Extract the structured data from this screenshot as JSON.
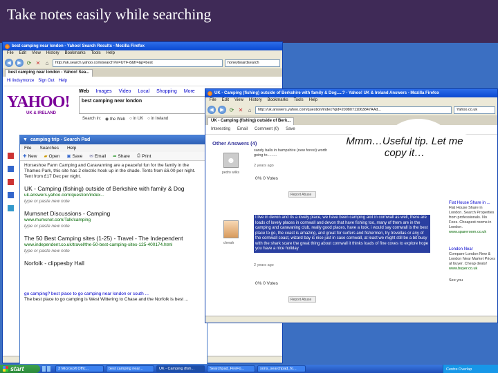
{
  "slide": {
    "title": "Take notes easily while searching"
  },
  "search_window": {
    "title": "best camping near london - Yahoo! Search Results - Mozilla Firefox",
    "menu": [
      "File",
      "Edit",
      "View",
      "History",
      "Bookmarks",
      "Tools",
      "Help"
    ],
    "url": "http://uk.search.yahoo.com/search?ei=UTF-8&fr=&p=best",
    "search_box": "honeyboardsearch",
    "tab_label": "best camping near london - Yahoo! Sea...",
    "header_links": [
      "Hi lindsymorze",
      "Sign Out",
      "Help"
    ],
    "logo": "YAHOO!",
    "logo_sub": "UK & IRELAND",
    "search_tabs": [
      "Web",
      "Images",
      "Video",
      "Local",
      "Shopping",
      "More"
    ],
    "query": "best camping near london",
    "search_in": {
      "label": "Search in:",
      "options": [
        "the Web",
        "in UK",
        "in Ireland"
      ]
    }
  },
  "search_pad": {
    "title": "camping trip - Search Pad",
    "menu": [
      "File",
      "Searches",
      "Help"
    ],
    "tools": [
      "New",
      "Open",
      "Save",
      "Email",
      "Share",
      "Print"
    ],
    "entries": [
      {
        "title": "Horseshoe Farm Camping and Caravanning are a peaceful fun for the family in the Thames Park, this site has 2 electric hook up in the shade. Tents from £6.00 per night. Tent from £17 Dec per night.",
        "url": "",
        "note": ""
      },
      {
        "title": "UK - Camping (fishing) outside of Berkshire with family & Dog",
        "url": "uk.answers.yahoo.com/question/index...",
        "note": "type or paste new note"
      },
      {
        "title": "Mumsnet Discussions - Camping",
        "url": "www.mumsnet.com/Talk/camping",
        "note": "type or paste new note"
      },
      {
        "title": "The 50 Best Camping sites (1-25) - Travel - The Independent",
        "url": "www.independent.co.uk/travel/the-50-best-camping-sites-125-400174.html",
        "note": "type or paste new note"
      },
      {
        "title": "Norfolk - clippesby Hall",
        "url": "",
        "note": ""
      }
    ],
    "bottom_note": "go camping? best place to go camping near london or south ...",
    "bottom_note2": "The best place to go camping is West Wittering to Chase and the Norfolk is best ..."
  },
  "answers_window": {
    "title": "UK - Camping (fishing) outside of Berkshire with family & Dog.....? - Yahoo! UK & Ireland Answers - Mozilla Firefox",
    "menu": [
      "File",
      "Edit",
      "View",
      "History",
      "Bookmarks",
      "Tools",
      "Help"
    ],
    "url": "http://uk.answers.yahoo.com/question/index?qid=20080711063847AAd...",
    "search_box": "Yahoo.co.uk",
    "tab_label": "UK - Camping (fishing) outside of Berk...",
    "toolbar": [
      "Interesting",
      "Email",
      "Comment (0)",
      "Save"
    ],
    "heading": "Other Answers (4)",
    "answer1": {
      "user": "pedro wilks",
      "text": "sandy balls in hampshire (new forest) worth going to.........",
      "ago": "2 years ago",
      "votes": "0% 0 Votes",
      "report": "Report Abuse"
    },
    "answer2": {
      "user": "cherah",
      "text": "I live in devon and its a lovely place, we have been camping alot in cornwall as well, there are loads of lovely places in cornwall and devon that have fishing too, many of them are in the camping and caravaning club, really good places, have a look, i would say cornwall is the best place to go, the coast is amazing, and great for surfers and fishermen, try trevellas or any of the cornwall coast, wizard bay is nice just in case cornwall, at least we might still be a bit busy with the shark scare the great thing about cornwall it thinks loads of fine coves to explore hope you have a nice holiday",
      "ago": "2 years ago",
      "votes": "0% 0 Votes",
      "report": "Report Abuse"
    },
    "ads": [
      {
        "head": "Flat House Share in ...",
        "body": "Flat House Share in London. Search Properties from professionals. No Fees. Cheapest rooms in London.",
        "url": "www.spareroom.co.uk"
      },
      {
        "head": "London Near",
        "body": "Compare London New & London Near Market Prices at buyer. Cheap deals!",
        "url": "www.buyer.co.uk"
      }
    ],
    "see_your": "See you"
  },
  "thought_bubble": {
    "text": "Mmm…Useful tip. Let me copy it…"
  },
  "taskbar": {
    "start": "start",
    "tasks": [
      "3 Microsoft Offic...",
      "best camping near...",
      "UK - Camping (fish...",
      "Searchpad_FireFo...",
      "sons_searchpad_fo..."
    ],
    "tray_text": "Centre Overlap"
  },
  "colors": {
    "slide_bg": "#3f2a57",
    "desktop_bg": "#3b6fc2",
    "yahoo_purple": "#7b0099",
    "highlight_bg": "#2a3fa0"
  }
}
